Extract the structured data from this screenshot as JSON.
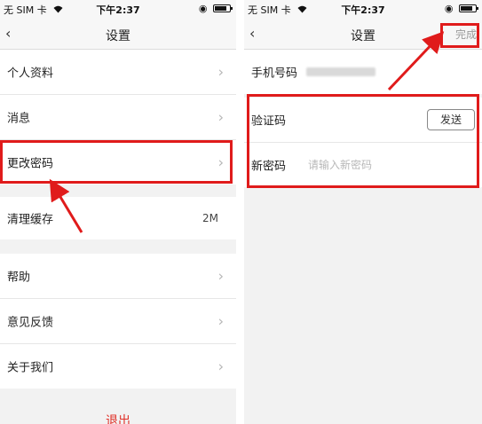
{
  "left": {
    "status": {
      "carrier": "无 SIM 卡",
      "time": "下午2:37"
    },
    "nav": {
      "back": "‹",
      "title": "设置"
    },
    "items": [
      {
        "label": "个人资料"
      },
      {
        "label": "消息"
      },
      {
        "label": "更改密码"
      },
      {
        "label": "清理缓存",
        "value": "2M"
      },
      {
        "label": "帮助"
      },
      {
        "label": "意见反馈"
      },
      {
        "label": "关于我们"
      }
    ],
    "logout": "退出"
  },
  "right": {
    "status": {
      "carrier": "无 SIM 卡",
      "time": "下午2:37"
    },
    "nav": {
      "back": "‹",
      "title": "设置",
      "done": "完成"
    },
    "phone_label": "手机号码",
    "code_label": "验证码",
    "send_label": "发送",
    "password_label": "新密码",
    "password_placeholder": "请输入新密码"
  },
  "colors": {
    "highlight": "#e01b1b",
    "logout": "#e0322a"
  }
}
